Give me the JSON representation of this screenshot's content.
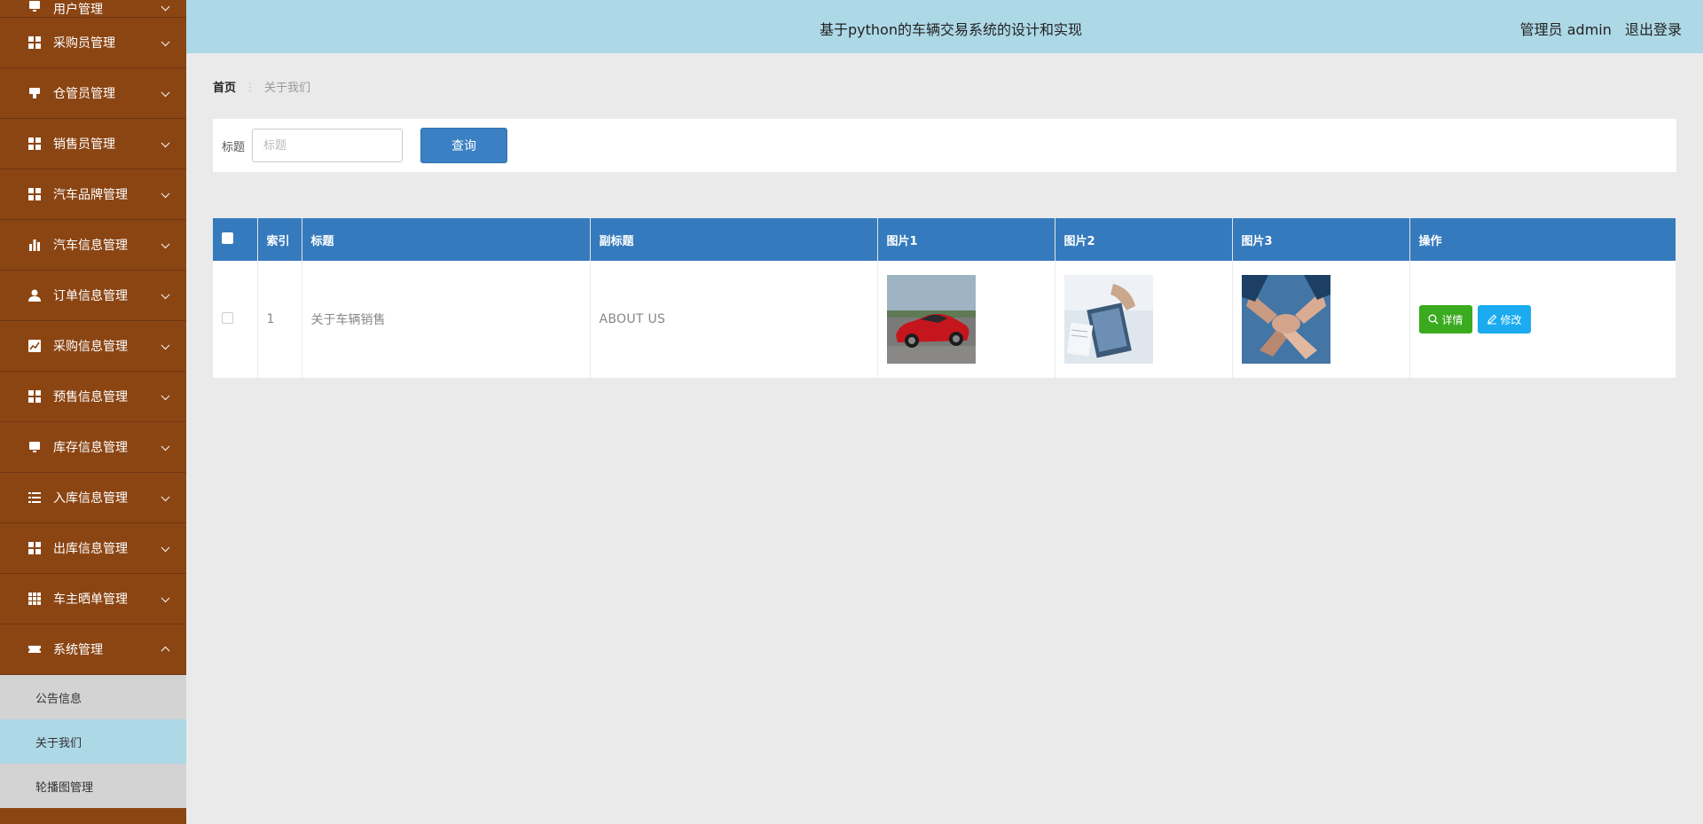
{
  "header": {
    "title": "基于python的车辆交易系统的设计和实现",
    "user_label": "管理员 admin",
    "logout_label": "退出登录"
  },
  "sidebar": {
    "items": [
      {
        "label": "用户管理",
        "icon": "monitor-icon"
      },
      {
        "label": "采购员管理",
        "icon": "grid-icon"
      },
      {
        "label": "仓管员管理",
        "icon": "stamp-icon"
      },
      {
        "label": "销售员管理",
        "icon": "grid-icon"
      },
      {
        "label": "汽车品牌管理",
        "icon": "grid-icon"
      },
      {
        "label": "汽车信息管理",
        "icon": "bar-chart-icon"
      },
      {
        "label": "订单信息管理",
        "icon": "user-icon"
      },
      {
        "label": "采购信息管理",
        "icon": "line-chart-icon"
      },
      {
        "label": "预售信息管理",
        "icon": "grid-icon"
      },
      {
        "label": "库存信息管理",
        "icon": "monitor-icon"
      },
      {
        "label": "入库信息管理",
        "icon": "list-icon"
      },
      {
        "label": "出库信息管理",
        "icon": "grid-icon"
      },
      {
        "label": "车主晒单管理",
        "icon": "table-icon"
      },
      {
        "label": "系统管理",
        "icon": "ticket-icon"
      }
    ],
    "sub_items": [
      {
        "label": "公告信息"
      },
      {
        "label": "关于我们"
      },
      {
        "label": "轮播图管理"
      }
    ]
  },
  "breadcrumb": {
    "home": "首页",
    "separator": "⋮",
    "current": "关于我们"
  },
  "search": {
    "label": "标题",
    "placeholder": "标题",
    "button": "查询"
  },
  "table": {
    "headers": [
      "索引",
      "标题",
      "副标题",
      "图片1",
      "图片2",
      "图片3",
      "操作"
    ],
    "rows": [
      {
        "index": "1",
        "title": "关于车辆销售",
        "subtitle": "ABOUT US",
        "images": [
          "red-sports-car-photo",
          "business-document-photo",
          "team-hands-photo"
        ],
        "detail_label": "详情",
        "edit_label": "修改"
      }
    ]
  },
  "colors": {
    "sidebar_bg": "#8b4513",
    "header_bg": "#add8e6",
    "table_header_bg": "#357abd",
    "query_button": "#3a80c2",
    "detail_button": "#3aab1e",
    "edit_button": "#1aabf0",
    "active_sub": "#add8e6"
  }
}
